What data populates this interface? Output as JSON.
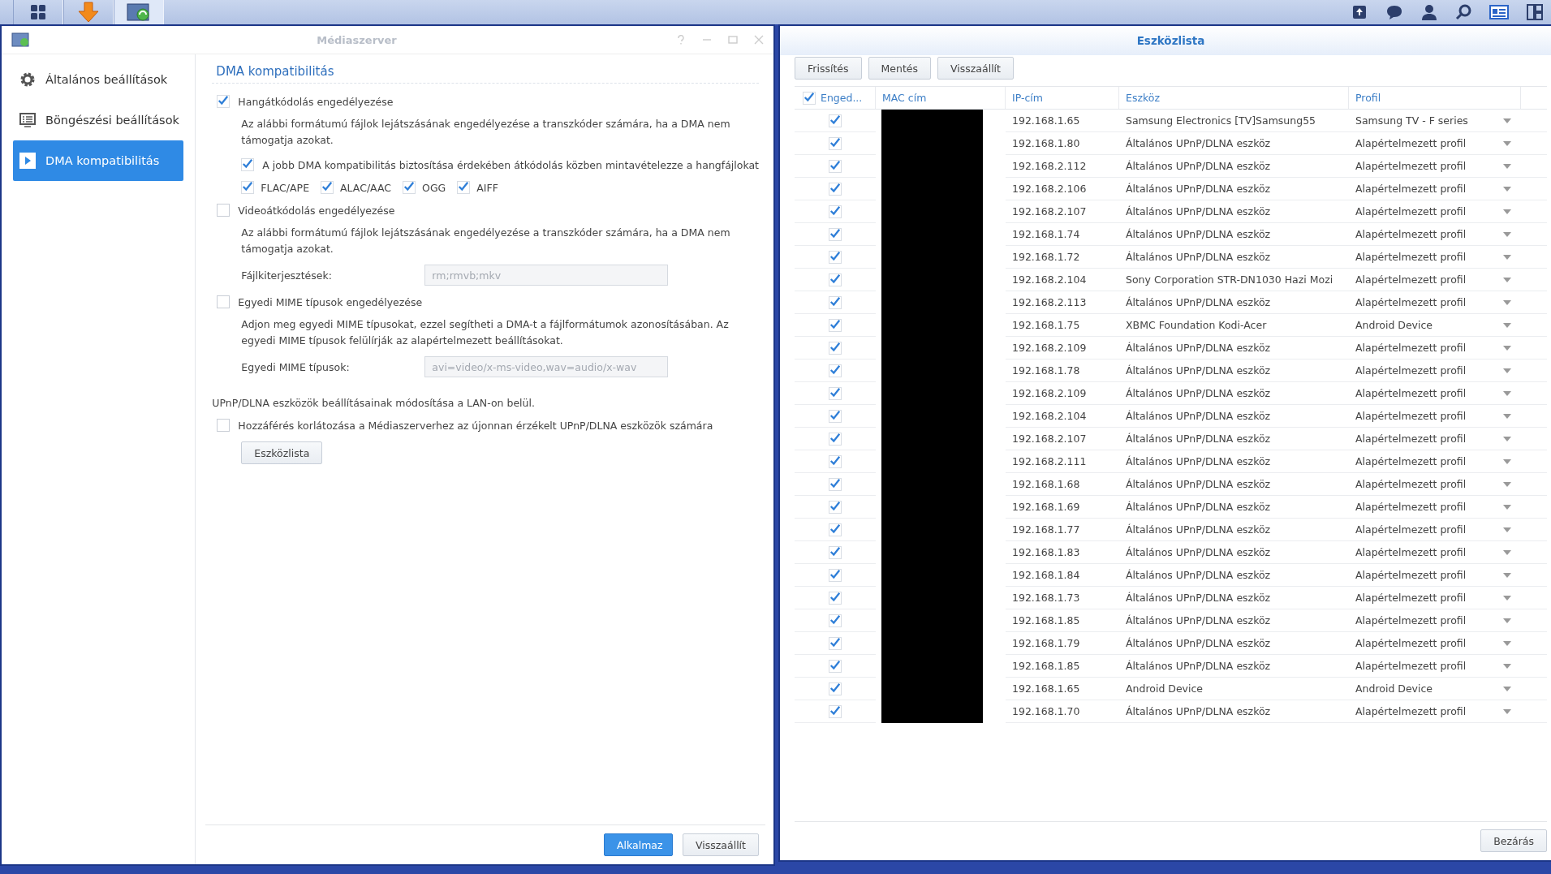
{
  "media_window": {
    "title": "Médiaszerver",
    "sidebar": [
      {
        "label": "Általános beállítások",
        "kind": "general",
        "selected": false
      },
      {
        "label": "Böngészési beállítások",
        "kind": "browse",
        "selected": false
      },
      {
        "label": "DMA kompatibilitás",
        "kind": "dma",
        "selected": true
      }
    ],
    "section_title": "DMA kompatibilitás",
    "audio": {
      "label": "Hangátkódolás engedélyezése",
      "checked": true,
      "description": "Az alábbi formátumú fájlok lejátszásának engedélyezése a transzkóder számára, ha a DMA nem támogatja azokat.",
      "resample": {
        "label": "A jobb DMA kompatibilitás biztosítása érdekében átkódolás közben mintavételezze a hangfájlokat",
        "checked": true
      },
      "formats": [
        {
          "label": "FLAC/APE",
          "checked": true
        },
        {
          "label": "ALAC/AAC",
          "checked": true
        },
        {
          "label": "OGG",
          "checked": true
        },
        {
          "label": "AIFF",
          "checked": true
        }
      ]
    },
    "video": {
      "label": "Videoátkódolás engedélyezése",
      "checked": false,
      "description": "Az alábbi formátumú fájlok lejátszásának engedélyezése a transzkóder számára, ha a DMA nem támogatja azokat.",
      "field": {
        "label": "Fájlkiterjesztések:",
        "value": "rm;rmvb;mkv",
        "disabled": true
      }
    },
    "mime": {
      "label": "Egyedi MIME típusok engedélyezése",
      "checked": false,
      "description": "Adjon meg egyedi MIME típusokat, ezzel segítheti a DMA-t a fájlformátumok azonosításában. Az egyedi MIME típusok felülírják az alapértelmezett beállításokat.",
      "field": {
        "label": "Egyedi MIME típusok:",
        "value": "avi=video/x-ms-video,wav=audio/x-wav",
        "disabled": true
      }
    },
    "upnp_note": "UPnP/DLNA eszközök beállításainak módosítása a LAN-on belül.",
    "restrict": {
      "label": "Hozzáférés korlátozása a Médiaszerverhez az újonnan érzékelt UPnP/DLNA eszközök számára",
      "checked": false
    },
    "device_list_button": "Eszközlista",
    "footer_buttons": [
      {
        "label": "Alkalmaz",
        "kind": "primary"
      },
      {
        "label": "Visszaállít",
        "kind": "default"
      }
    ]
  },
  "device_window": {
    "title": "Eszközlista",
    "toolbar": [
      "Frissítés",
      "Mentés",
      "Visszaállít"
    ],
    "columns": [
      {
        "label": "Enged...",
        "checked": true
      },
      {
        "label": "MAC cím"
      },
      {
        "label": "IP-cím"
      },
      {
        "label": "Eszköz"
      },
      {
        "label": "Profil"
      }
    ],
    "rows": [
      {
        "enabled": true,
        "redacted": true,
        "ip": "192.168.1.65",
        "device": "Samsung Electronics [TV]Samsung55",
        "profile": "Samsung TV - F series"
      },
      {
        "enabled": true,
        "redacted": true,
        "ip": "192.168.1.80",
        "device": "Általános UPnP/DLNA eszköz",
        "profile": "Alapértelmezett profil"
      },
      {
        "enabled": true,
        "redacted": true,
        "ip": "192.168.2.112",
        "device": "Általános UPnP/DLNA eszköz",
        "profile": "Alapértelmezett profil"
      },
      {
        "enabled": true,
        "redacted": true,
        "ip": "192.168.2.106",
        "device": "Általános UPnP/DLNA eszköz",
        "profile": "Alapértelmezett profil"
      },
      {
        "enabled": true,
        "redacted": true,
        "ip": "192.168.2.107",
        "device": "Általános UPnP/DLNA eszköz",
        "profile": "Alapértelmezett profil"
      },
      {
        "enabled": true,
        "redacted": true,
        "ip": "192.168.1.74",
        "device": "Általános UPnP/DLNA eszköz",
        "profile": "Alapértelmezett profil"
      },
      {
        "enabled": true,
        "redacted": true,
        "ip": "192.168.1.72",
        "device": "Általános UPnP/DLNA eszköz",
        "profile": "Alapértelmezett profil"
      },
      {
        "enabled": true,
        "redacted": true,
        "ip": "192.168.2.104",
        "device": "Sony Corporation STR-DN1030 Hazi Mozi",
        "profile": "Alapértelmezett profil"
      },
      {
        "enabled": true,
        "redacted": true,
        "ip": "192.168.2.113",
        "device": "Általános UPnP/DLNA eszköz",
        "profile": "Alapértelmezett profil"
      },
      {
        "enabled": true,
        "redacted": true,
        "ip": "192.168.1.75",
        "device": "XBMC Foundation Kodi-Acer",
        "profile": "Android Device"
      },
      {
        "enabled": true,
        "redacted": true,
        "ip": "192.168.2.109",
        "device": "Általános UPnP/DLNA eszköz",
        "profile": "Alapértelmezett profil"
      },
      {
        "enabled": true,
        "redacted": true,
        "ip": "192.168.1.78",
        "device": "Általános UPnP/DLNA eszköz",
        "profile": "Alapértelmezett profil"
      },
      {
        "enabled": true,
        "redacted": true,
        "ip": "192.168.2.109",
        "device": "Általános UPnP/DLNA eszköz",
        "profile": "Alapértelmezett profil"
      },
      {
        "enabled": true,
        "redacted": true,
        "ip": "192.168.2.104",
        "device": "Általános UPnP/DLNA eszköz",
        "profile": "Alapértelmezett profil"
      },
      {
        "enabled": true,
        "redacted": true,
        "ip": "192.168.2.107",
        "device": "Általános UPnP/DLNA eszköz",
        "profile": "Alapértelmezett profil"
      },
      {
        "enabled": true,
        "redacted": true,
        "ip": "192.168.2.111",
        "device": "Általános UPnP/DLNA eszköz",
        "profile": "Alapértelmezett profil"
      },
      {
        "enabled": true,
        "redacted": true,
        "ip": "192.168.1.68",
        "device": "Általános UPnP/DLNA eszköz",
        "profile": "Alapértelmezett profil"
      },
      {
        "enabled": true,
        "redacted": true,
        "ip": "192.168.1.69",
        "device": "Általános UPnP/DLNA eszköz",
        "profile": "Alapértelmezett profil"
      },
      {
        "enabled": true,
        "redacted": true,
        "ip": "192.168.1.77",
        "device": "Általános UPnP/DLNA eszköz",
        "profile": "Alapértelmezett profil"
      },
      {
        "enabled": true,
        "redacted": true,
        "ip": "192.168.1.83",
        "device": "Általános UPnP/DLNA eszköz",
        "profile": "Alapértelmezett profil"
      },
      {
        "enabled": true,
        "redacted": true,
        "ip": "192.168.1.84",
        "device": "Általános UPnP/DLNA eszköz",
        "profile": "Alapértelmezett profil"
      },
      {
        "enabled": true,
        "redacted": true,
        "ip": "192.168.1.73",
        "device": "Általános UPnP/DLNA eszköz",
        "profile": "Alapértelmezett profil"
      },
      {
        "enabled": true,
        "redacted": true,
        "ip": "192.168.1.85",
        "device": "Általános UPnP/DLNA eszköz",
        "profile": "Alapértelmezett profil"
      },
      {
        "enabled": true,
        "redacted": true,
        "ip": "192.168.1.79",
        "device": "Általános UPnP/DLNA eszköz",
        "profile": "Alapértelmezett profil"
      },
      {
        "enabled": true,
        "redacted": true,
        "ip": "192.168.1.85",
        "device": "Általános UPnP/DLNA eszköz",
        "profile": "Alapértelmezett profil"
      },
      {
        "enabled": true,
        "redacted": true,
        "ip": "192.168.1.65",
        "device": "Android Device",
        "profile": "Android Device"
      },
      {
        "enabled": true,
        "redacted": true,
        "ip": "192.168.1.70",
        "device": "Általános UPnP/DLNA eszköz",
        "profile": "Alapértelmezett profil"
      }
    ],
    "close_button": "Bezárás"
  }
}
